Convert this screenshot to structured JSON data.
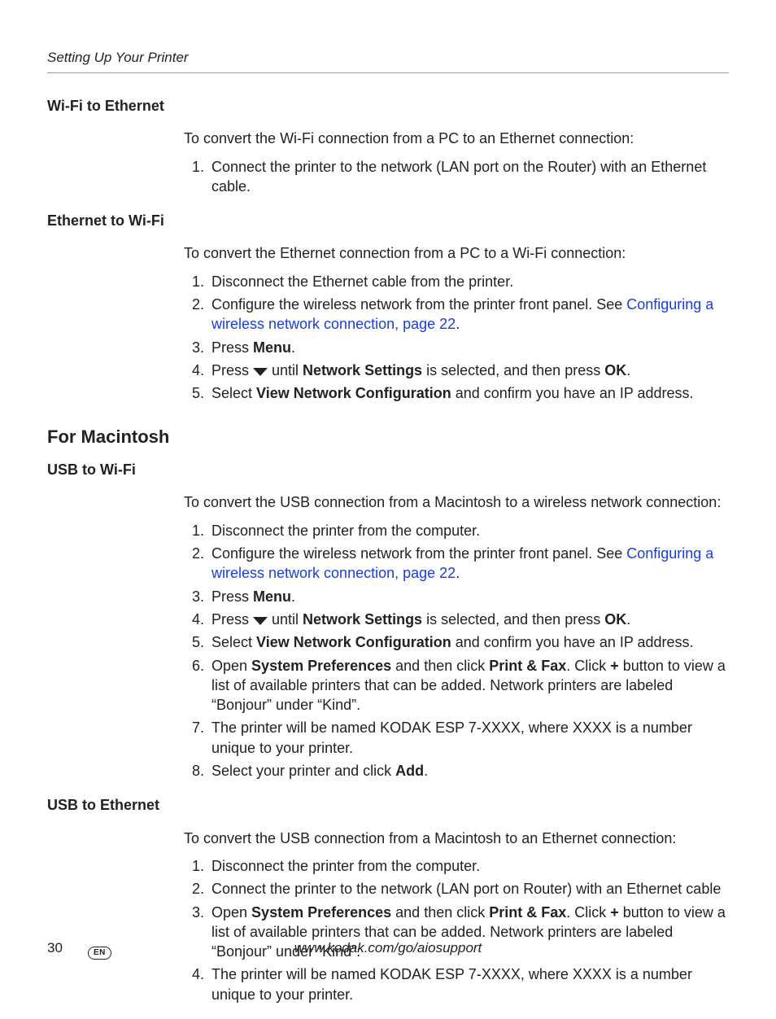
{
  "header": {
    "running_title": "Setting Up Your Printer"
  },
  "sections": {
    "s1": {
      "heading": "Wi-Fi to Ethernet",
      "intro": "To convert the Wi-Fi connection from a PC to an Ethernet connection:",
      "step1": "Connect the printer to the network (LAN port on the Router) with an Ethernet cable."
    },
    "s2": {
      "heading": "Ethernet to Wi-Fi",
      "intro": "To convert the Ethernet connection from a PC to a Wi-Fi connection:",
      "step1": "Disconnect the Ethernet cable from the printer.",
      "step2a": "Configure the wireless network from the printer front panel. See ",
      "step2_link": "Configuring a wireless network connection, page 22",
      "step2b": ".",
      "step3a": "Press ",
      "step3b": "Menu",
      "step3c": ".",
      "step4a": "Press ",
      "step4b": " until ",
      "step4c": "Network Settings",
      "step4d": " is selected, and then press ",
      "step4e": "OK",
      "step4f": ".",
      "step5a": "Select ",
      "step5b": "View Network Configuration",
      "step5c": " and confirm you have an IP address."
    },
    "mac_heading": "For Macintosh",
    "s3": {
      "heading": "USB to Wi-Fi",
      "intro": "To convert the USB connection from a Macintosh to a wireless network connection:",
      "step1": "Disconnect the printer from the computer.",
      "step2a": "Configure the wireless network from the printer front panel. See ",
      "step2_link": "Configuring a wireless network connection, page 22",
      "step2b": ".",
      "step3a": "Press ",
      "step3b": "Menu",
      "step3c": ".",
      "step4a": "Press ",
      "step4b": " until ",
      "step4c": "Network Settings",
      "step4d": " is selected, and then press ",
      "step4e": "OK",
      "step4f": ".",
      "step5a": "Select ",
      "step5b": "View Network Configuration",
      "step5c": " and confirm you have an IP address.",
      "step6a": "Open ",
      "step6b": "System Preferences",
      "step6c": " and then click ",
      "step6d": "Print & Fax",
      "step6e": ". Click ",
      "step6f": "+",
      "step6g": " button to view a list of available printers that can be added. Network printers are labeled “Bonjour” under “Kind”.",
      "step7": "The printer will be named KODAK ESP 7-XXXX, where XXXX is a number unique to your printer.",
      "step8a": "Select your printer and click ",
      "step8b": "Add",
      "step8c": "."
    },
    "s4": {
      "heading": "USB to Ethernet",
      "intro": "To convert the USB connection from a Macintosh to an Ethernet connection:",
      "step1": "Disconnect the printer from the computer.",
      "step2": "Connect the printer to the network (LAN port on Router) with an Ethernet cable",
      "step3a": "Open ",
      "step3b": "System Preferences",
      "step3c": " and then click ",
      "step3d": "Print & Fax",
      "step3e": ". Click ",
      "step3f": "+",
      "step3g": " button to view a list of available printers that can be added. Network printers are labeled “Bonjour” under “Kind”.",
      "step4": "The printer will be named KODAK ESP 7-XXXX, where XXXX is a number unique to your printer."
    }
  },
  "footer": {
    "page_number": "30",
    "lang_code": "EN",
    "url": "www.kodak.com/go/aiosupport"
  }
}
